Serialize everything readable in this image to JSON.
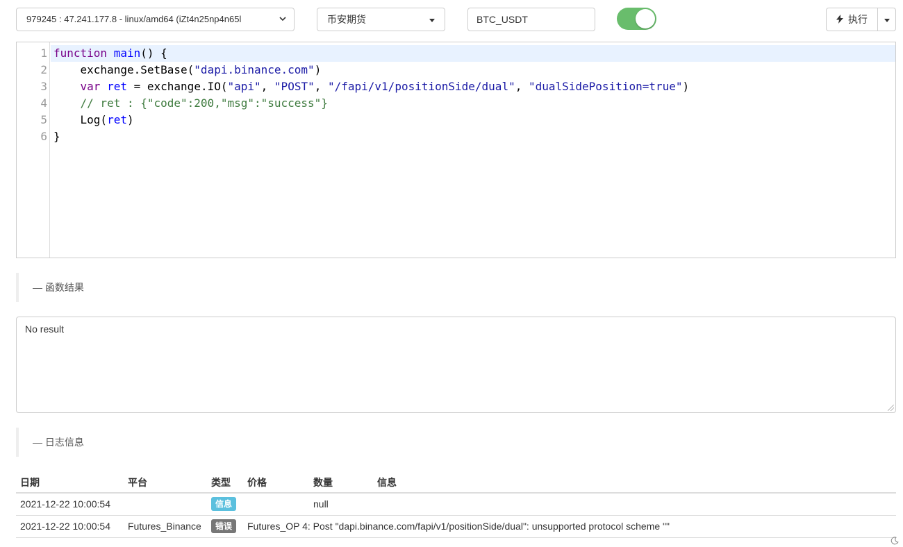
{
  "toolbar": {
    "node": "979245 : 47.241.177.8 - linux/amd64 (iZt4n25np4n65l",
    "exchange": "币安期货",
    "pair": "BTC_USDT",
    "toggle_on": true,
    "toggle_color": "#69bd6c",
    "run_icon": "bolt-icon",
    "run_label": "执行"
  },
  "editor": {
    "line_numbers": [
      "1",
      "2",
      "3",
      "4",
      "5",
      "6"
    ],
    "lines": [
      "function main() {",
      "    exchange.SetBase(\"dapi.binance.com\")",
      "    var ret = exchange.IO(\"api\", \"POST\", \"/fapi/v1/positionSide/dual\", \"dualSidePosition=true\")",
      "    // ret : {\"code\":200,\"msg\":\"success\"}",
      "    Log(ret)",
      "}"
    ],
    "active_line": 1
  },
  "sections": {
    "result_title": "— 函数结果",
    "log_title": "— 日志信息"
  },
  "result": {
    "text": "No result"
  },
  "log": {
    "headers": [
      "日期",
      "平台",
      "类型",
      "价格",
      "数量",
      "信息"
    ],
    "rows": [
      {
        "date": "2021-12-22 10:00:54",
        "platform": "",
        "type": "信息",
        "type_color": "#5bc0de",
        "price": "",
        "amount": "",
        "info": "null"
      },
      {
        "date": "2021-12-22 10:00:54",
        "platform": "Futures_Binance",
        "type": "错误",
        "type_color": "#777777",
        "price": "",
        "amount": "",
        "info": "Futures_OP 4: Post \"dapi.binance.com/fapi/v1/positionSide/dual\": unsupported protocol scheme \"\""
      }
    ]
  },
  "footer": {
    "theme_icon": "moon-icon"
  }
}
